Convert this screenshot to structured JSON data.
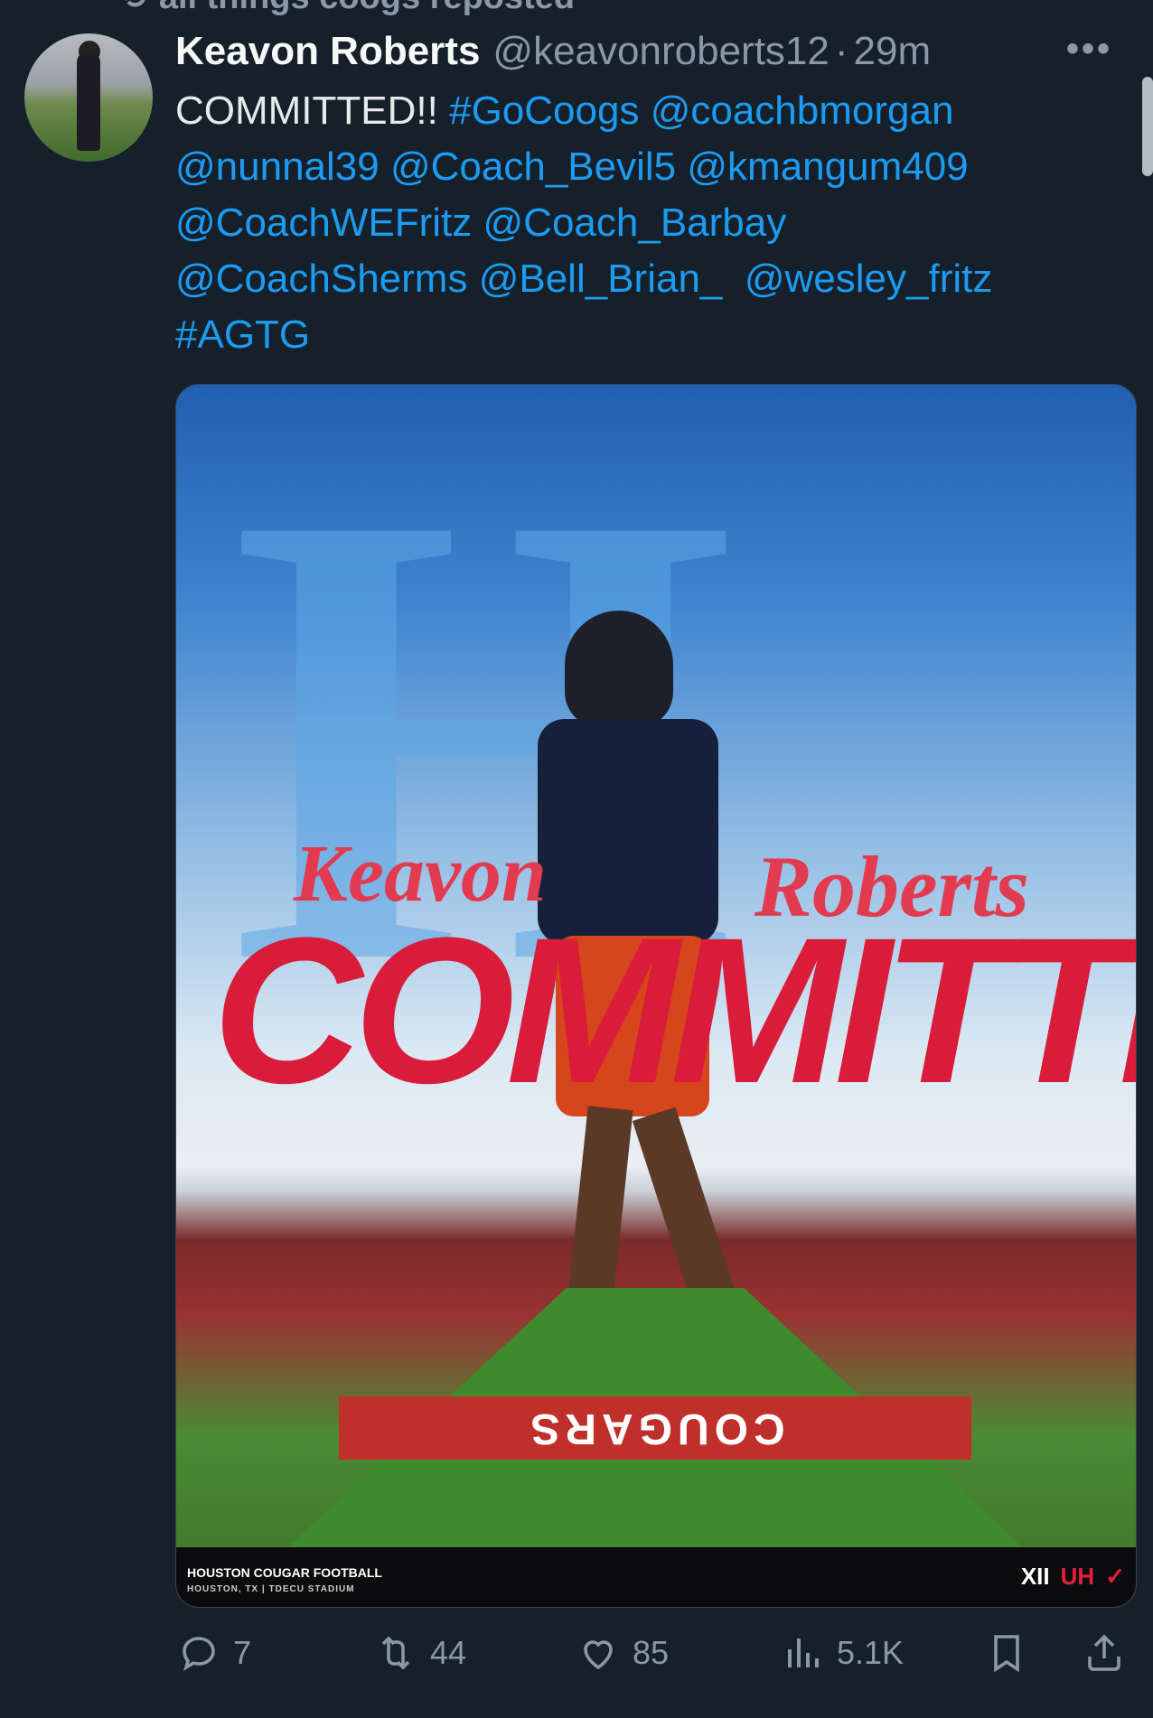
{
  "repost_banner": {
    "label": "all things coogs reposted"
  },
  "tweet": {
    "author_name": "Keavon Roberts",
    "handle": "@keavonroberts12",
    "separator": "·",
    "time": "29m",
    "more_label": "•••",
    "text": {
      "t1": "COMMITTED!! ",
      "l1": "#GoCoogs",
      "l2": "@coachbmorgan",
      "l3": "@nunnal39",
      "l4": "@Coach_Bevil5",
      "l5": "@kmangum409",
      "l6": "@CoachWEFritz",
      "l7": "@Coach_Barbay",
      "l8": "@CoachSherms",
      "l9": "@Bell_Brian_",
      "l10": "@wesley_fritz",
      "l11": "#AGTG"
    },
    "media": {
      "big_letter": "H",
      "script_first": "Keavon",
      "script_last": "Roberts",
      "headline": "COMMITTED",
      "endzone": "COUGARS",
      "footer_title": "HOUSTON COUGAR FOOTBALL",
      "footer_sub": "HOUSTON, TX | TDECU STADIUM",
      "logo_xii": "XII",
      "logo_uh": "UH",
      "logo_swoosh": "✓",
      "colors": {
        "red": "#d81c39",
        "blue": "#5ea7e6"
      }
    },
    "actions": {
      "replies": "7",
      "reposts": "44",
      "likes": "85",
      "views": "5.1K"
    }
  },
  "colors": {
    "background": "#15202b",
    "link": "#1d9bf0",
    "muted": "#8b98a5"
  }
}
